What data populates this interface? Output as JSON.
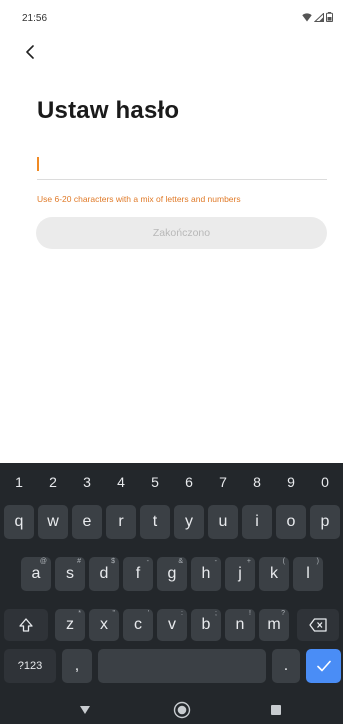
{
  "status": {
    "time": "21:56"
  },
  "page": {
    "title": "Ustaw hasło",
    "hint": "Use 6-20 characters with a mix of letters and numbers",
    "done_label": "Zakończono",
    "password_value": ""
  },
  "keyboard": {
    "numbers": [
      "1",
      "2",
      "3",
      "4",
      "5",
      "6",
      "7",
      "8",
      "9",
      "0"
    ],
    "row1": [
      "q",
      "w",
      "e",
      "r",
      "t",
      "y",
      "u",
      "i",
      "o",
      "p"
    ],
    "row2": [
      {
        "key": "a",
        "alt": "@"
      },
      {
        "key": "s",
        "alt": "#"
      },
      {
        "key": "d",
        "alt": "$"
      },
      {
        "key": "f",
        "alt": "-"
      },
      {
        "key": "g",
        "alt": "&"
      },
      {
        "key": "h",
        "alt": "-"
      },
      {
        "key": "j",
        "alt": "+"
      },
      {
        "key": "k",
        "alt": "("
      },
      {
        "key": "l",
        "alt": ")"
      }
    ],
    "row3": [
      {
        "key": "z",
        "alt": "*"
      },
      {
        "key": "x",
        "alt": "\""
      },
      {
        "key": "c",
        "alt": "'"
      },
      {
        "key": "v",
        "alt": ":"
      },
      {
        "key": "b",
        "alt": ";"
      },
      {
        "key": "n",
        "alt": "!"
      },
      {
        "key": "m",
        "alt": "?"
      }
    ],
    "symbols_label": "?123",
    "comma": ",",
    "period": ".",
    "icons": {
      "shift": "shift-icon",
      "backspace": "backspace-icon",
      "enter": "checkmark-icon"
    },
    "accent_color": "#4a8df6"
  },
  "colors": {
    "hint": "#e07a28",
    "caret": "#f08a24",
    "keyboard_bg": "#23272b",
    "key_bg": "#3b4045"
  }
}
